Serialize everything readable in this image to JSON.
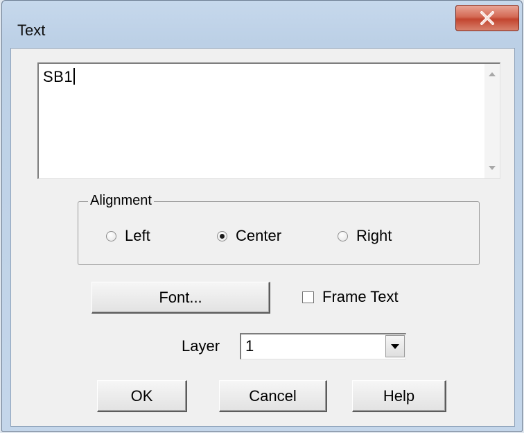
{
  "window": {
    "title": "Text"
  },
  "text_field": {
    "value": "SB1"
  },
  "alignment": {
    "legend": "Alignment",
    "options": [
      {
        "label": "Left",
        "checked": false
      },
      {
        "label": "Center",
        "checked": true
      },
      {
        "label": "Right",
        "checked": false
      }
    ]
  },
  "font_button": {
    "label": "Font..."
  },
  "frame_text": {
    "label": "Frame Text",
    "checked": false
  },
  "layer": {
    "label": "Layer",
    "value": "1"
  },
  "buttons": {
    "ok": "OK",
    "cancel": "Cancel",
    "help": "Help"
  },
  "icons": {
    "close": "close-icon",
    "scroll_up": "chevron-up-icon",
    "scroll_down": "chevron-down-icon",
    "dropdown": "chevron-down-icon"
  },
  "colors": {
    "close_button": "#c3452f",
    "title_bar": "#c6d8ec",
    "client_bg": "#f0f0f0"
  }
}
